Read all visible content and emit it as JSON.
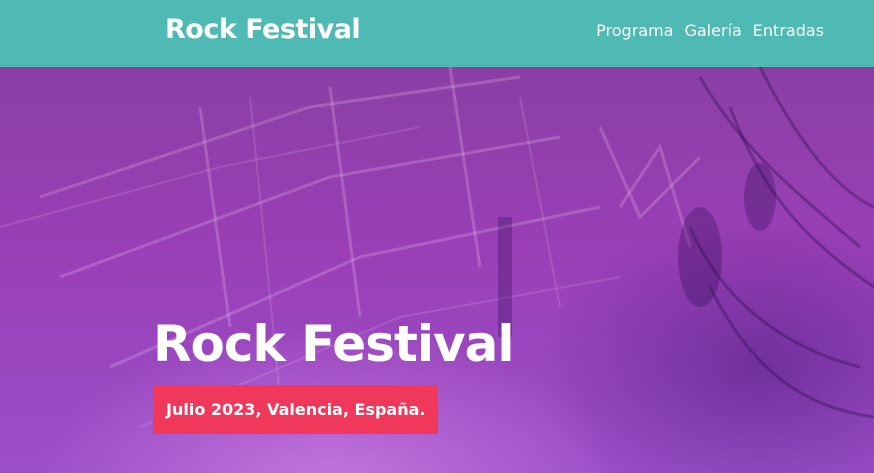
{
  "header": {
    "brand": "Rock Festival",
    "nav": [
      "Programa",
      "Galería",
      "Entradas"
    ]
  },
  "hero": {
    "title": "Rock Festival",
    "subtitle": "Julio 2023, Valencia, España."
  },
  "colors": {
    "header_bg": "#4fb9b4",
    "hero_overlay": "#9a3fb6",
    "badge_bg": "#f0385b",
    "text": "#ffffff"
  }
}
